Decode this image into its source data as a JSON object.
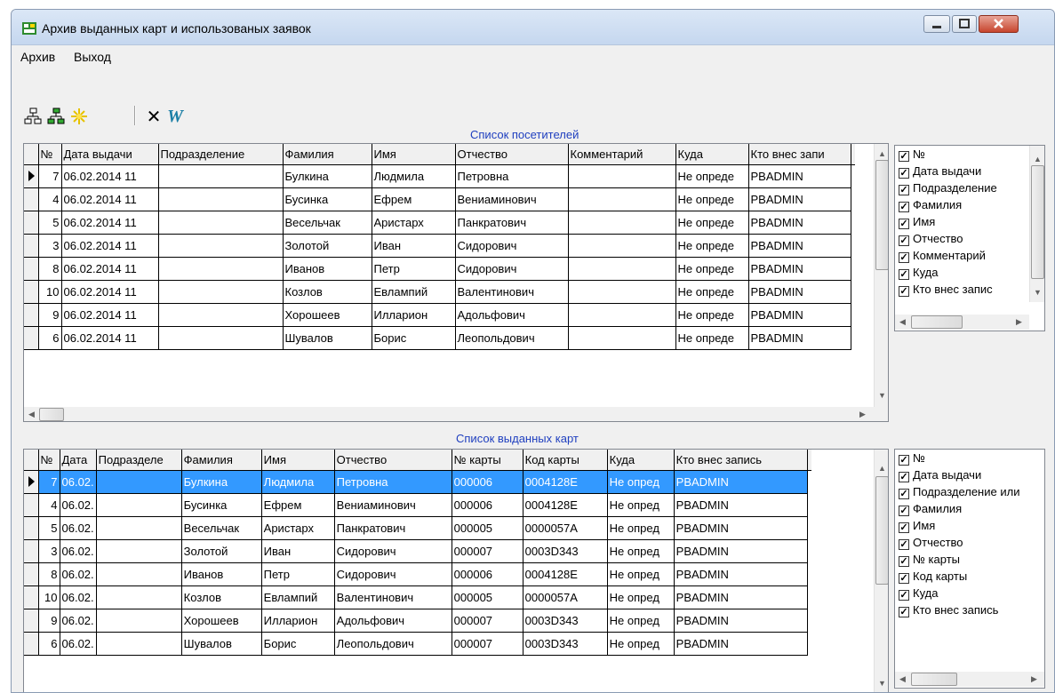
{
  "window": {
    "title": "Архив выданных карт и использованых заявок"
  },
  "menu": [
    "Архив",
    "Выход"
  ],
  "toolbar": {
    "close_glyph": "✕",
    "w_glyph": "W"
  },
  "visitors": {
    "title": "Список посетителей",
    "columns": [
      "№",
      "Дата выдачи",
      "Подразделение",
      "Фамилия",
      "Имя",
      "Отчество",
      "Комментарий",
      "Куда",
      "Кто внес запи"
    ],
    "rows": [
      [
        "7",
        "06.02.2014 11",
        "",
        "Булкина",
        "Людмила",
        "Петровна",
        "",
        "Не опреде",
        "PBADMIN"
      ],
      [
        "4",
        "06.02.2014 11",
        "",
        "Бусинка",
        "Ефрем",
        "Вениаминович",
        "",
        "Не опреде",
        "PBADMIN"
      ],
      [
        "5",
        "06.02.2014 11",
        "",
        "Весельчак",
        "Аристарх",
        "Панкратович",
        "",
        "Не опреде",
        "PBADMIN"
      ],
      [
        "3",
        "06.02.2014 11",
        "",
        "Золотой",
        "Иван",
        "Сидорович",
        "",
        "Не опреде",
        "PBADMIN"
      ],
      [
        "8",
        "06.02.2014 11",
        "",
        "Иванов",
        "Петр",
        "Сидорович",
        "",
        "Не опреде",
        "PBADMIN"
      ],
      [
        "10",
        "06.02.2014 11",
        "",
        "Козлов",
        "Евлампий",
        "Валентинович",
        "",
        "Не опреде",
        "PBADMIN"
      ],
      [
        "9",
        "06.02.2014 11",
        "",
        "Хорошеев",
        "Илларион",
        "Адольфович",
        "",
        "Не опреде",
        "PBADMIN"
      ],
      [
        "6",
        "06.02.2014 11",
        "",
        "Шувалов",
        "Борис",
        "Леопольдович",
        "",
        "Не опреде",
        "PBADMIN"
      ]
    ],
    "checklist": [
      "№",
      "Дата выдачи",
      "Подразделение",
      "Фамилия",
      "Имя",
      "Отчество",
      "Комментарий",
      "Куда",
      "Кто внес запис"
    ]
  },
  "cards": {
    "title": "Список выданных карт",
    "columns": [
      "№",
      "Дата",
      "Подразделе",
      "Фамилия",
      "Имя",
      "Отчество",
      "№ карты",
      "Код карты",
      "Куда",
      "Кто внес запись"
    ],
    "rows": [
      [
        "7",
        "06.02.",
        "",
        "Булкина",
        "Людмила",
        "Петровна",
        "000006",
        "0004128E",
        "Не опред",
        "PBADMIN"
      ],
      [
        "4",
        "06.02.",
        "",
        "Бусинка",
        "Ефрем",
        "Вениаминович",
        "000006",
        "0004128E",
        "Не опред",
        "PBADMIN"
      ],
      [
        "5",
        "06.02.",
        "",
        "Весельчак",
        "Аристарх",
        "Панкратович",
        "000005",
        "0000057A",
        "Не опред",
        "PBADMIN"
      ],
      [
        "3",
        "06.02.",
        "",
        "Золотой",
        "Иван",
        "Сидорович",
        "000007",
        "0003D343",
        "Не опред",
        "PBADMIN"
      ],
      [
        "8",
        "06.02.",
        "",
        "Иванов",
        "Петр",
        "Сидорович",
        "000006",
        "0004128E",
        "Не опред",
        "PBADMIN"
      ],
      [
        "10",
        "06.02.",
        "",
        "Козлов",
        "Евлампий",
        "Валентинович",
        "000005",
        "0000057A",
        "Не опред",
        "PBADMIN"
      ],
      [
        "9",
        "06.02.",
        "",
        "Хорошеев",
        "Илларион",
        "Адольфович",
        "000007",
        "0003D343",
        "Не опред",
        "PBADMIN"
      ],
      [
        "6",
        "06.02.",
        "",
        "Шувалов",
        "Борис",
        "Леопольдович",
        "000007",
        "0003D343",
        "Не опред",
        "PBADMIN"
      ]
    ],
    "checklist": [
      "№",
      "Дата выдачи",
      "Подразделение или",
      "Фамилия",
      "Имя",
      "Отчество",
      "№ карты",
      "Код карты",
      "Куда",
      "Кто внес запись"
    ]
  },
  "colors": {
    "selection": "#3399ff",
    "section_title": "#1f3fbf"
  }
}
